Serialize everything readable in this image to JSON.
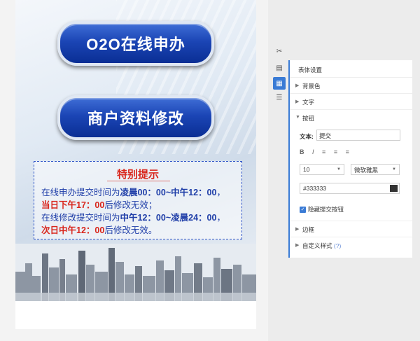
{
  "page": {
    "buttons": {
      "o2o": "O2O在线申办",
      "modify": "商户资料修改"
    },
    "notice": {
      "title": "特别提示",
      "line1_pre": "在线申办提交时间为",
      "line1_bold": "凌晨00：00~中午12：00",
      "line1_end": "，",
      "line2_red": "当日下午17：00",
      "line2_end": "后修改无效；",
      "line3_pre": "在线修改提交时间为",
      "line3_bold": "中午12：00~凌晨24：00",
      "line3_end": "，",
      "line4_red": "次日中午12：00",
      "line4_end": "后修改无效。"
    }
  },
  "toolbar": {
    "icons": [
      "tools-icon",
      "page-icon",
      "form-icon",
      "layers-icon"
    ],
    "active": 2
  },
  "panel": {
    "title": "表体设置",
    "sections": {
      "background": "背景色",
      "text": "文字",
      "button": "按钮",
      "border": "边框",
      "custom_style": "自定义样式",
      "custom_help": "(?)"
    },
    "button": {
      "text_label": "文本:",
      "text_value": "提交",
      "format": [
        "B",
        "I",
        "≡",
        "≡",
        "≡"
      ],
      "font_size": "10",
      "font_family": "微软雅黑",
      "color_value": "#333333",
      "hide_submit_label": "隐藏提交按钮",
      "hide_submit_checked": true
    }
  },
  "colors": {
    "accent": "#3a7bd5",
    "button_blue": "#1b45b5",
    "notice_red": "#d9261c",
    "notice_blue": "#1f3ea8",
    "swatch": "#333333"
  }
}
